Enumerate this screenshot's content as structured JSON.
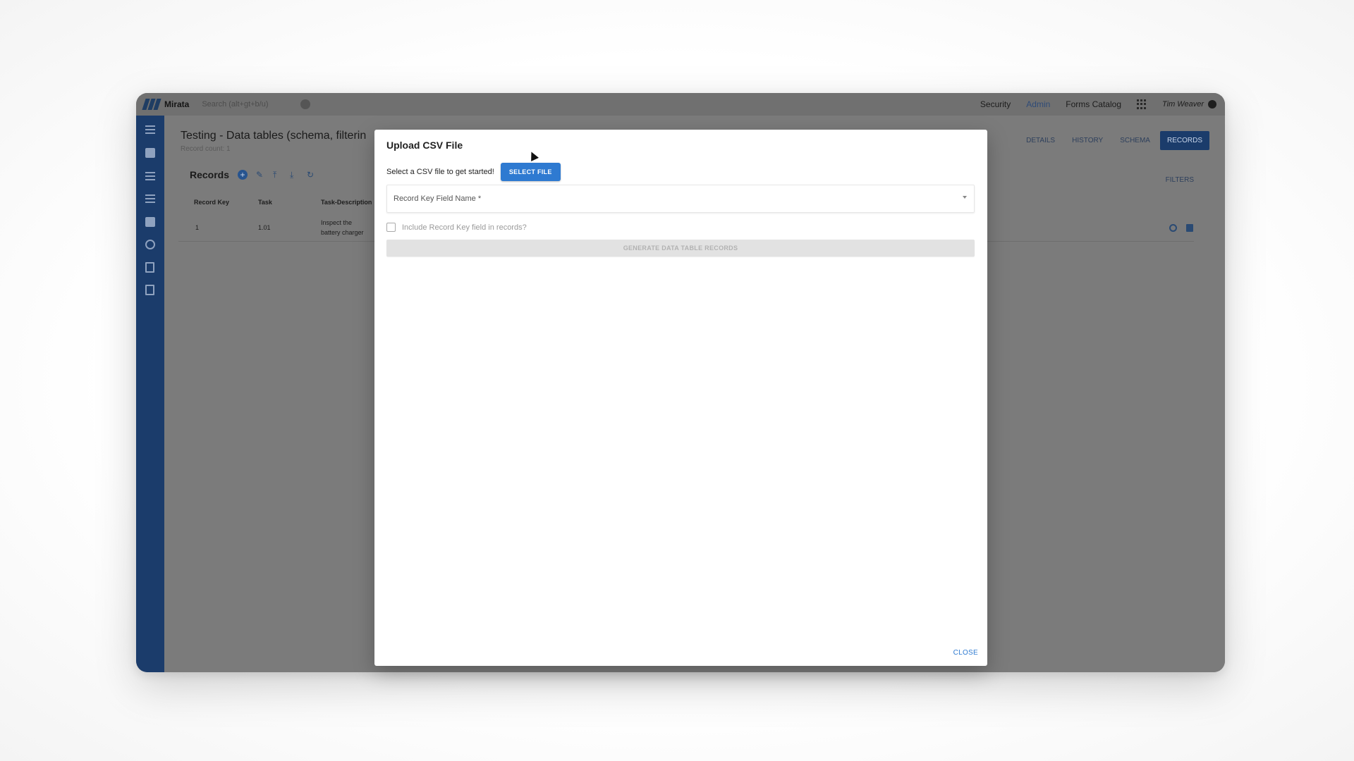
{
  "app": {
    "brand": "Mirata",
    "search_placeholder": "Search (alt+gt+b/u)",
    "nav": [
      "Security",
      "Admin",
      "Forms Catalog"
    ],
    "user_name": "Tim Weaver"
  },
  "page": {
    "title": "Testing - Data tables (schema, filterin",
    "subtitle": "Record count: 1",
    "tabs": [
      "DETAILS",
      "HISTORY",
      "SCHEMA",
      "RECORDS"
    ],
    "active_tab": "RECORDS",
    "records_label": "Records",
    "filters_label": "FILTERS",
    "columns": [
      "Record Key",
      "Task",
      "Task-Description"
    ],
    "rows": [
      {
        "record_key": "1",
        "task": "1.01",
        "description_line1": "Inspect the",
        "description_line2": "battery charger"
      }
    ]
  },
  "modal": {
    "title": "Upload CSV File",
    "select_prompt": "Select a CSV file to get started!",
    "select_button": "SELECT FILE",
    "record_key_field_label": "Record Key Field Name *",
    "include_checkbox_label": "Include Record Key field in records?",
    "include_checked": false,
    "generate_button": "GENERATE DATA TABLE RECORDS",
    "close_button": "CLOSE"
  },
  "colors": {
    "primary": "#2e7ad1",
    "sidebar": "#1b3c6b"
  }
}
